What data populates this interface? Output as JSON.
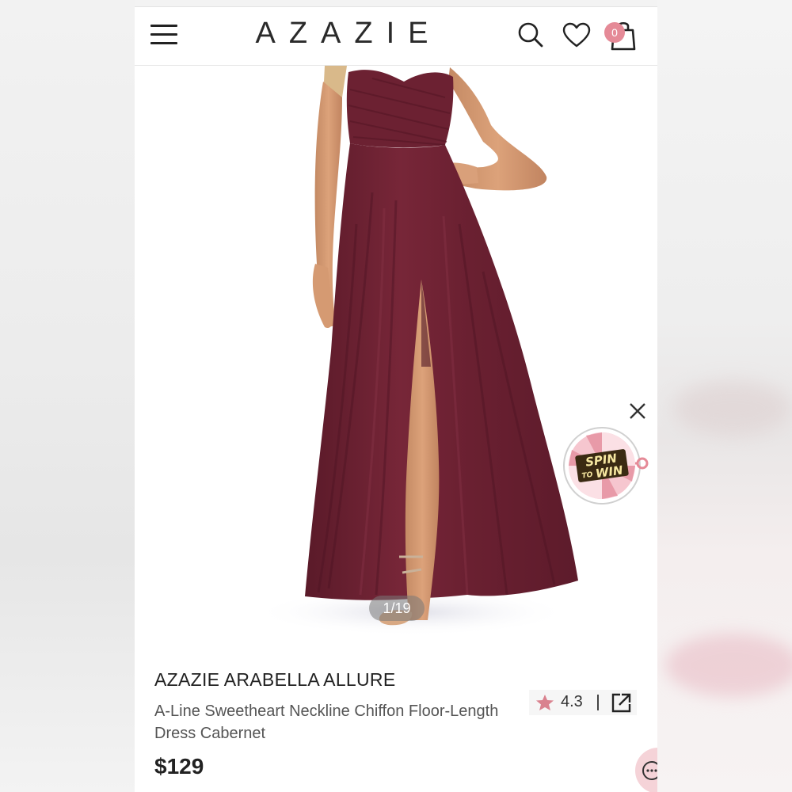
{
  "header": {
    "logo": "AZAZIE",
    "cart_count": "0",
    "icons": [
      "menu-icon",
      "search-icon",
      "heart-icon",
      "shopping-bag-icon"
    ]
  },
  "gallery": {
    "counter": "1/19",
    "spin_badge": {
      "line1": "SPIN",
      "line2_a": "TO",
      "line2_b": "WIN"
    }
  },
  "product": {
    "brand": "AZAZIE ARABELLA ALLURE",
    "description": "A-Line Sweetheart Neckline Chiffon Floor-Length Dress Cabernet",
    "price": "$129",
    "rating": "4.3"
  },
  "colors": {
    "accent": "#e58a97",
    "dress": "#6e2233",
    "text": "#222222"
  }
}
